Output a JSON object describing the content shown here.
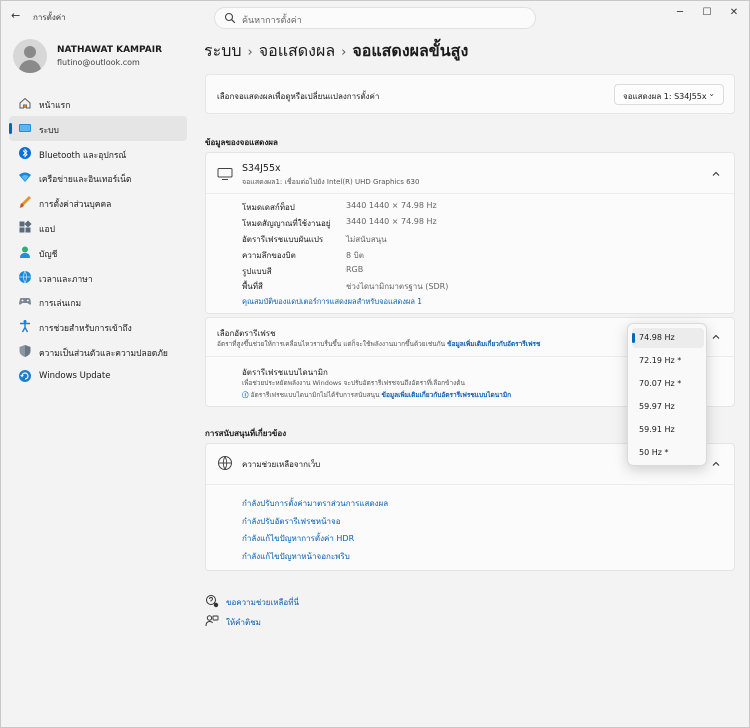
{
  "window": {
    "app_title": "การตั้งค่า",
    "search_placeholder": "ค้นหาการตั้งค่า",
    "minimize": "─",
    "maximize": "☐",
    "close": "✕",
    "back": "←"
  },
  "profile": {
    "name": "NATHAWAT KAMPAIR",
    "email": "flutino@outlook.com"
  },
  "sidebar": {
    "items": [
      {
        "label": "หน้าแรก",
        "icon": "home-icon",
        "active": false
      },
      {
        "label": "ระบบ",
        "icon": "system-icon",
        "active": true
      },
      {
        "label": "Bluetooth และอุปกรณ์",
        "icon": "bluetooth-icon",
        "active": false
      },
      {
        "label": "เครือข่ายและอินเทอร์เน็ต",
        "icon": "wifi-icon",
        "active": false
      },
      {
        "label": "การตั้งค่าส่วนบุคคล",
        "icon": "brush-icon",
        "active": false
      },
      {
        "label": "แอป",
        "icon": "apps-icon",
        "active": false
      },
      {
        "label": "บัญชี",
        "icon": "account-icon",
        "active": false
      },
      {
        "label": "เวลาและภาษา",
        "icon": "time-language-icon",
        "active": false
      },
      {
        "label": "การเล่นเกม",
        "icon": "gamepad-icon",
        "active": false
      },
      {
        "label": "การช่วยสำหรับการเข้าถึง",
        "icon": "accessibility-icon",
        "active": false
      },
      {
        "label": "ความเป็นส่วนตัวและความปลอดภัย",
        "icon": "shield-icon",
        "active": false
      },
      {
        "label": "Windows Update",
        "icon": "update-icon",
        "active": false
      }
    ]
  },
  "breadcrumb": {
    "items": [
      "ระบบ",
      "จอแสดงผล",
      "จอแสดงผลขั้นสูง"
    ],
    "separator": "›"
  },
  "selector": {
    "label": "เลือกจอแสดงผลเพื่อดูหรือเปลี่ยนแปลงการตั้งค่า",
    "value": "จอแสดงผล 1: S34J55x",
    "chevron": "⌄"
  },
  "display_info": {
    "section_title": "ข้อมูลของจอแสดงผล",
    "name": "S34J55x",
    "subtitle": "จอแสดงผล1: เชื่อมต่อไปยัง Intel(R) UHD Graphics 630",
    "rows": [
      {
        "key": "โหมดเดสก์ท็อป",
        "value": "3440 1440 × 74.98 Hz"
      },
      {
        "key": "โหมดสัญญาณที่ใช้งานอยู่",
        "value": "3440 1440 × 74.98 Hz"
      },
      {
        "key": "อัตรารีเฟรชแบบผันแปร",
        "value": "ไม่สนับสนุน"
      },
      {
        "key": "ความลึกของบิต",
        "value": "8 บิต"
      },
      {
        "key": "รูปแบบสี",
        "value": "RGB"
      },
      {
        "key": "พื้นที่สี",
        "value": "ช่วงไดนามิกมาตรฐาน (SDR)"
      }
    ],
    "adapter_link": "คุณสมบัติของแดปเตอร์การแสดงผลสำหรับจอแสดงผล 1"
  },
  "refresh_rate": {
    "title": "เลือกอัตรารีเฟรช",
    "description": "อัตราที่สูงขึ้นช่วยให้การเคลื่อนไหวราบรื่นขึ้น แต่ก็จะใช้พลังงานมากขึ้นด้วยเช่นกัน",
    "description_link": "ข้อมูลเพิ่มเติมเกี่ยวกับอัตรารีเฟรช",
    "dynamic_title": "อัตรารีเฟรชแบบไดนามิก",
    "dynamic_desc": "เพื่อช่วยประหยัดพลังงาน Windows จะปรับอัตรารีเฟรชจนถึงอัตราที่เลือกข้างต้น",
    "dynamic_note": "อัตรารีเฟรชแบบไดนามิกไม่ได้รับการสนับสนุน",
    "dynamic_note_link": "ข้อมูลเพิ่มเติมเกี่ยวกับอัตรารีเฟรชแบบไดนามิก",
    "info_icon": "ⓘ",
    "options": [
      "74.98 Hz",
      "72.19 Hz *",
      "70.07 Hz *",
      "59.97 Hz",
      "59.91 Hz",
      "50 Hz *"
    ],
    "selected_index": 0
  },
  "related": {
    "section_title": "การสนับสนุนที่เกี่ยวข้อง",
    "card_title": "ความช่วยเหลือจากเว็บ",
    "links": [
      "กำลังปรับการตั้งค่ามาตราส่วนการแสดงผล",
      "กำลังปรับอัตรารีเฟรชหน้าจอ",
      "กำลังแก้ไขปัญหาการตั้งค่า HDR",
      "กำลังแก้ไขปัญหาหน้าจอกะพริบ"
    ]
  },
  "footer": {
    "help": "ขอความช่วยเหลือที่นี่",
    "feedback": "ให้คำติชม"
  },
  "colors": {
    "accent": "#0067c0",
    "link": "#0a5fb4"
  }
}
